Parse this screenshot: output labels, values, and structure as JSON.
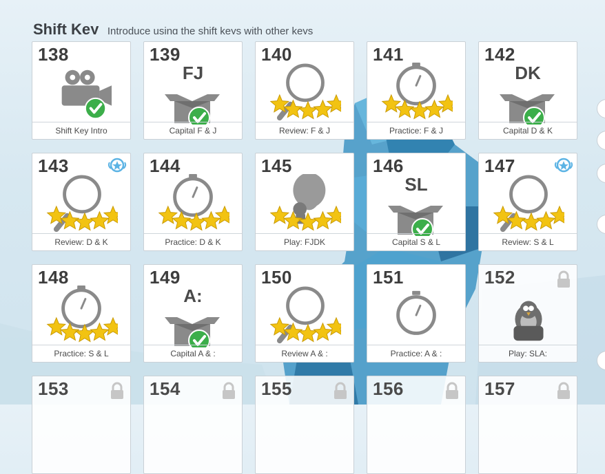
{
  "section": {
    "title": "Shift Key",
    "description": "Introduce using the shift keys with other keys"
  },
  "colors": {
    "star": "#f2c312",
    "check": "#3cae4a",
    "icon_gray": "#8a8a8a",
    "badge_blue": "#5bb3e4"
  },
  "lessons": [
    {
      "num": "138",
      "label": "Shift Key Intro",
      "icon": "video-camera-icon",
      "complete": true
    },
    {
      "num": "139",
      "keys": "FJ",
      "label": "Capital F & J",
      "icon": "open-box-icon",
      "complete": true
    },
    {
      "num": "140",
      "label": "Review: F & J",
      "icon": "magnifier-icon",
      "stars": 5
    },
    {
      "num": "141",
      "label": "Practice: F & J",
      "icon": "stopwatch-icon",
      "stars": 5
    },
    {
      "num": "142",
      "keys": "DK",
      "label": "Capital D & K",
      "icon": "open-box-icon",
      "complete": true
    },
    {
      "num": "143",
      "label": "Review: D & K",
      "icon": "magnifier-icon",
      "stars": 5,
      "badge": "wings-badge-icon"
    },
    {
      "num": "144",
      "label": "Practice: D & K",
      "icon": "stopwatch-icon",
      "stars": 5
    },
    {
      "num": "145",
      "label": "Play: FJDK",
      "icon": "balloon-game-icon",
      "stars": 5
    },
    {
      "num": "146",
      "keys": "SL",
      "label": "Capital S & L",
      "icon": "open-box-icon",
      "complete": true
    },
    {
      "num": "147",
      "label": "Review: S & L",
      "icon": "magnifier-icon",
      "stars": 5,
      "badge": "wings-badge-icon"
    },
    {
      "num": "148",
      "label": "Practice: S & L",
      "icon": "stopwatch-icon",
      "stars": 5
    },
    {
      "num": "149",
      "keys": "A:",
      "label": "Capital A & :",
      "icon": "open-box-icon",
      "complete": true
    },
    {
      "num": "150",
      "label": "Review A & :",
      "icon": "magnifier-icon",
      "stars": 5
    },
    {
      "num": "151",
      "label": "Practice: A & :",
      "icon": "stopwatch-icon"
    },
    {
      "num": "152",
      "label": "Play: SLA:",
      "icon": "penguin-pot-game-icon",
      "locked": true
    },
    {
      "num": "153",
      "label": "",
      "locked": true
    },
    {
      "num": "154",
      "label": "",
      "locked": true
    },
    {
      "num": "155",
      "label": "",
      "locked": true
    },
    {
      "num": "156",
      "label": "",
      "locked": true
    },
    {
      "num": "157",
      "label": "",
      "locked": true
    }
  ]
}
